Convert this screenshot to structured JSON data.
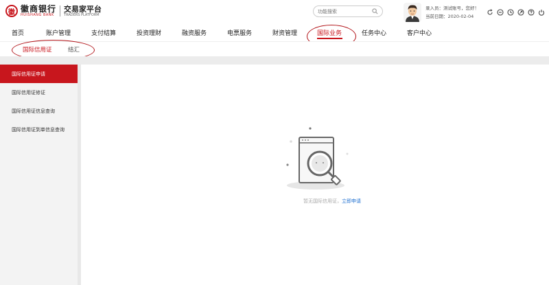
{
  "brand": {
    "name": "徽商银行",
    "name_en": "HUISHANG BANK",
    "platform": "交易家平台",
    "platform_en": "TRADERS PLATFORM",
    "accent": "#c8161d"
  },
  "search": {
    "placeholder": "功能搜索",
    "icon": "search-icon"
  },
  "user": {
    "greeting": "录入员：测试账号，您好！",
    "date": "当前日期：2020-02-04"
  },
  "toolbar": {
    "icons": [
      "refresh-icon",
      "minus-circle-icon",
      "clock-icon",
      "switch-icon",
      "help-icon",
      "power-icon"
    ]
  },
  "nav": {
    "items": [
      "首页",
      "账户管理",
      "支付结算",
      "投资理财",
      "融资服务",
      "电票服务",
      "财资管理",
      "国际业务",
      "任务中心",
      "客户中心"
    ],
    "active": "国际业务"
  },
  "subnav": {
    "items": [
      "国际信用证",
      "结汇"
    ],
    "active": "国际信用证"
  },
  "sidebar": {
    "items": [
      "国际信用证申请",
      "国际信用证修证",
      "国际信用证信息查询",
      "国际信用证到单信息查询"
    ],
    "active": "国际信用证申请"
  },
  "empty_state": {
    "text": "暂无国际信用证，",
    "link": "立即申请"
  }
}
